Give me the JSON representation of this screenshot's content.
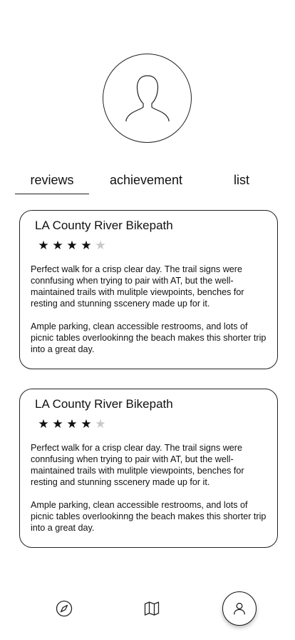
{
  "profile": {
    "avatar_icon": "user-silhouette-icon"
  },
  "tabs": [
    {
      "label": "reviews",
      "active": true
    },
    {
      "label": "achievement",
      "active": false
    },
    {
      "label": "list",
      "active": false
    }
  ],
  "reviews": [
    {
      "title": "LA County River Bikepath",
      "rating": 4,
      "max_rating": 5,
      "paragraph1": "Perfect walk for a crisp clear day. The trail signs were connfusing when trying  to pair with AT, but the well-maintained trails with mulitple viewpoints, benches for resting and stunning sscenery made up for it.",
      "paragraph2": "Ample parking, clean accessible restrooms, and lots of picnic tables overlookinng the beach makes this shorter trip into a great day."
    },
    {
      "title": "LA County River Bikepath",
      "rating": 4,
      "max_rating": 5,
      "paragraph1": "Perfect walk for a crisp clear day. The trail signs were connfusing when trying  to pair with AT, but the well-maintained trails with mulitple viewpoints, benches for resting and stunning sscenery made up for it.",
      "paragraph2": "Ample parking, clean accessible restrooms, and lots of picnic tables overlookinng the beach makes this shorter trip into a great day."
    }
  ],
  "bottom_nav": {
    "items": [
      {
        "icon": "compass-icon",
        "active": false
      },
      {
        "icon": "map-icon",
        "active": false
      },
      {
        "icon": "profile-icon",
        "active": true
      }
    ]
  },
  "colors": {
    "star_filled": "#111111",
    "star_empty": "#c8c8c8",
    "border": "#222222"
  }
}
